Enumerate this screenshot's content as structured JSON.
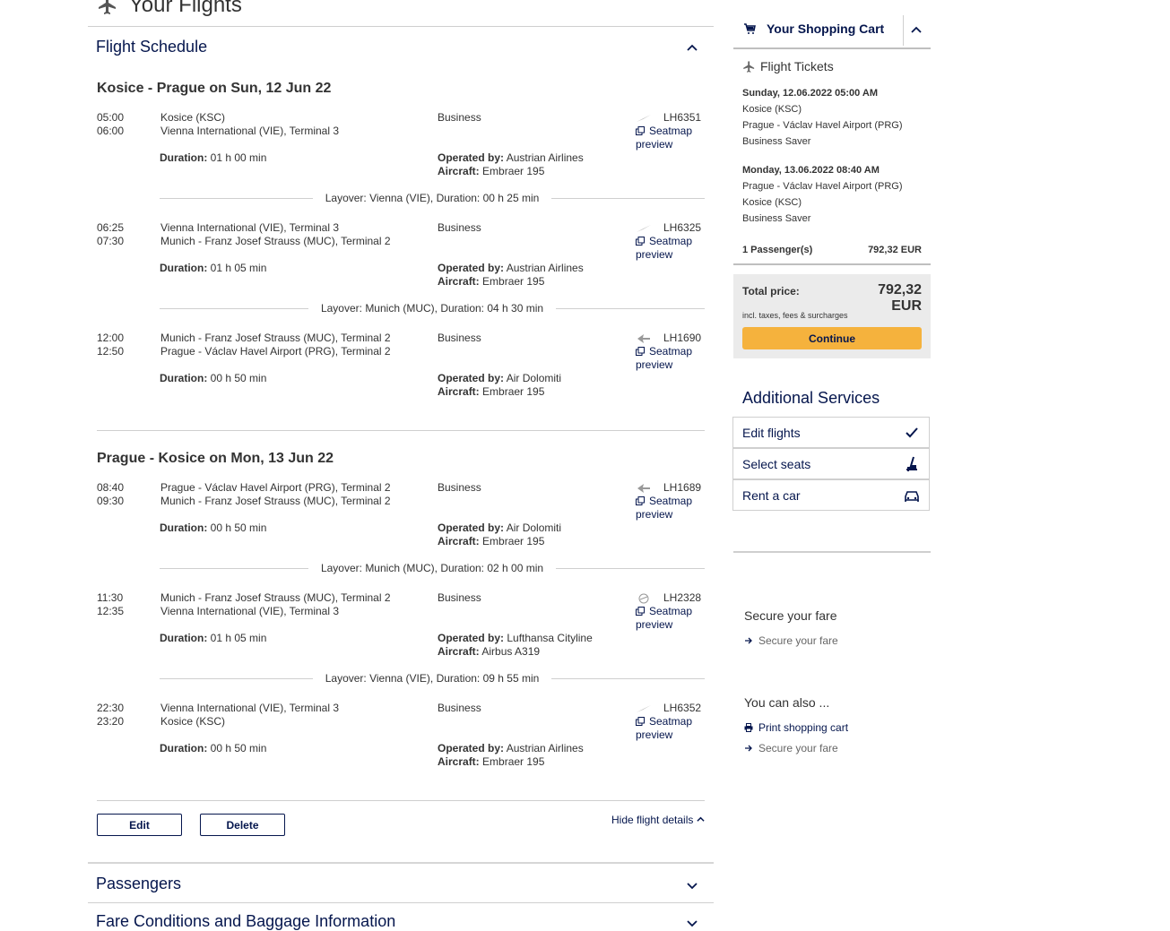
{
  "page": {
    "title": "Your Flights"
  },
  "schedule": {
    "title": "Flight Schedule",
    "legs": [
      {
        "title": "Kosice - Prague on Sun, 12 Jun 22",
        "segments": [
          {
            "dep": "05:00",
            "arr": "06:00",
            "from": "Kosice (KSC)",
            "to": "Vienna International (VIE), Terminal 3",
            "class": "Business",
            "duration_label": "Duration:",
            "duration": "01 h 00 min",
            "operated_label": "Operated by:",
            "operated": "Austrian Airlines",
            "aircraft_label": "Aircraft:",
            "aircraft": "Embraer 195",
            "flight": "LH6351",
            "seatmap": "Seatmap preview",
            "carrier_icon": "austrian-airlines-logo-icon"
          },
          {
            "dep": "06:25",
            "arr": "07:30",
            "from": "Vienna International (VIE), Terminal 3",
            "to": "Munich - Franz Josef Strauss (MUC), Terminal 2",
            "class": "Business",
            "duration_label": "Duration:",
            "duration": "01 h 05 min",
            "operated_label": "Operated by:",
            "operated": "Austrian Airlines",
            "aircraft_label": "Aircraft:",
            "aircraft": "Embraer 195",
            "flight": "LH6325",
            "seatmap": "Seatmap preview",
            "carrier_icon": "austrian-airlines-logo-icon"
          },
          {
            "dep": "12:00",
            "arr": "12:50",
            "from": "Munich - Franz Josef Strauss (MUC), Terminal 2",
            "to": "Prague - Václav Havel Airport (PRG), Terminal 2",
            "class": "Business",
            "duration_label": "Duration:",
            "duration": "00 h 50 min",
            "operated_label": "Operated by:",
            "operated": "Air Dolomiti",
            "aircraft_label": "Aircraft:",
            "aircraft": "Embraer 195",
            "flight": "LH1690",
            "seatmap": "Seatmap preview",
            "carrier_icon": "air-dolomiti-logo-icon"
          }
        ],
        "layovers": [
          "Layover: Vienna (VIE), Duration: 00 h 25 min",
          "Layover: Munich (MUC), Duration: 04 h 30 min"
        ]
      },
      {
        "title": "Prague - Kosice on Mon, 13 Jun 22",
        "segments": [
          {
            "dep": "08:40",
            "arr": "09:30",
            "from": "Prague - Václav Havel Airport (PRG), Terminal 2",
            "to": "Munich - Franz Josef Strauss (MUC), Terminal 2",
            "class": "Business",
            "duration_label": "Duration:",
            "duration": "00 h 50 min",
            "operated_label": "Operated by:",
            "operated": "Air Dolomiti",
            "aircraft_label": "Aircraft:",
            "aircraft": "Embraer 195",
            "flight": "LH1689",
            "seatmap": "Seatmap preview",
            "carrier_icon": "air-dolomiti-logo-icon"
          },
          {
            "dep": "11:30",
            "arr": "12:35",
            "from": "Munich - Franz Josef Strauss (MUC), Terminal 2",
            "to": "Vienna International (VIE), Terminal 3",
            "class": "Business",
            "duration_label": "Duration:",
            "duration": "01 h 05 min",
            "operated_label": "Operated by:",
            "operated": "Lufthansa Cityline",
            "aircraft_label": "Aircraft:",
            "aircraft": "Airbus A319",
            "flight": "LH2328",
            "seatmap": "Seatmap preview",
            "carrier_icon": "lufthansa-logo-icon"
          },
          {
            "dep": "22:30",
            "arr": "23:20",
            "from": "Vienna International (VIE), Terminal 3",
            "to": "Kosice (KSC)",
            "class": "Business",
            "duration_label": "Duration:",
            "duration": "00 h 50 min",
            "operated_label": "Operated by:",
            "operated": "Austrian Airlines",
            "aircraft_label": "Aircraft:",
            "aircraft": "Embraer 195",
            "flight": "LH6352",
            "seatmap": "Seatmap preview",
            "carrier_icon": "austrian-airlines-logo-icon"
          }
        ],
        "layovers": [
          "Layover: Munich (MUC), Duration: 02 h 00 min",
          "Layover: Vienna (VIE), Duration: 09 h 55 min"
        ]
      }
    ],
    "edit_label": "Edit",
    "delete_label": "Delete",
    "hide_details": "Hide flight details"
  },
  "passengers": {
    "title": "Passengers"
  },
  "fare_conditions": {
    "title": "Fare Conditions and Baggage Information"
  },
  "cart": {
    "title": "Your Shopping Cart",
    "tickets_title": "Flight Tickets",
    "outbound": {
      "date": "Sunday, 12.06.2022 05:00 AM",
      "from": "Kosice (KSC)",
      "to": "Prague - Václav Havel Airport (PRG)",
      "fare": "Business Saver"
    },
    "inbound": {
      "date": "Monday, 13.06.2022 08:40 AM",
      "from": "Prague - Václav Havel Airport (PRG)",
      "to": "Kosice (KSC)",
      "fare": "Business Saver"
    },
    "passengers": "1 Passenger(s)",
    "passengers_price": "792,32 EUR",
    "total_label": "Total price:",
    "total": "792,32 EUR",
    "taxes_note": "incl. taxes, fees & surcharges",
    "continue_label": "Continue"
  },
  "additional": {
    "title": "Additional Services",
    "items": [
      {
        "label": "Edit flights",
        "icon": "checkmark-icon"
      },
      {
        "label": "Select seats",
        "icon": "seat-icon"
      },
      {
        "label": "Rent a car",
        "icon": "car-icon"
      }
    ]
  },
  "secure": {
    "title": "Secure your fare",
    "link": "Secure your fare"
  },
  "also": {
    "title": "You can also ...",
    "print": "Print shopping cart",
    "secure": "Secure your fare"
  },
  "colors": {
    "navy": "#05164d",
    "accent": "#f5b23d",
    "panel": "#ebebeb"
  }
}
